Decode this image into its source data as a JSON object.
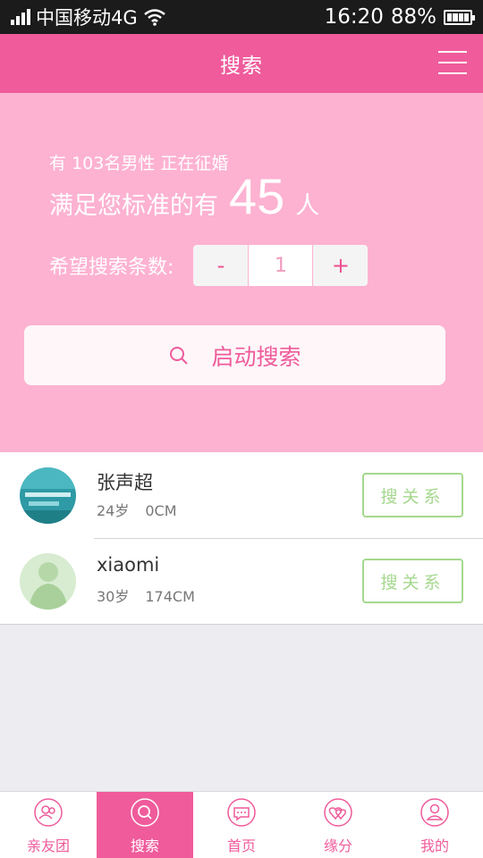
{
  "status_bar": {
    "carrier": "中国移动4G",
    "time": "16:20",
    "battery": "88%"
  },
  "header": {
    "title": "搜索"
  },
  "hero": {
    "count_line_prefix": "有",
    "count_line_value": "103",
    "count_line_suffix": "名男性 正在征婚",
    "match_prefix": "满足您标准的有",
    "match_count": "45",
    "match_suffix": "人",
    "stepper_label": "希望搜索条数:",
    "stepper_minus": "-",
    "stepper_value": "1",
    "stepper_plus": "+",
    "search_button": "启动搜索"
  },
  "results": [
    {
      "name": "张声超",
      "age": "24岁",
      "height": "0CM",
      "action": "搜关系"
    },
    {
      "name": "xiaomi",
      "age": "30岁",
      "height": "174CM",
      "action": "搜关系"
    }
  ],
  "tabs": [
    {
      "label": "亲友团",
      "icon": "group-icon"
    },
    {
      "label": "搜索",
      "icon": "search-icon",
      "active": true
    },
    {
      "label": "首页",
      "icon": "chat-bubble-icon"
    },
    {
      "label": "缘分",
      "icon": "hearts-icon"
    },
    {
      "label": "我的",
      "icon": "profile-icon"
    }
  ],
  "colors": {
    "primary": "#ef5b9b",
    "hero_bg": "#fdb2d1",
    "action_green": "#a5d88e"
  }
}
